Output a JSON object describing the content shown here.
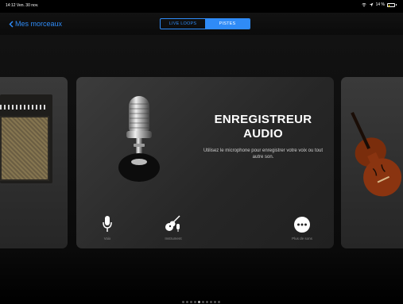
{
  "status": {
    "time_date": "14:12  Ven. 30 nov.",
    "battery_text": "14 %",
    "battery_level_percent": 14,
    "battery_color": "#ffd60a"
  },
  "nav": {
    "back_label": "Mes morceaux",
    "accent_color": "#2f8bf7"
  },
  "segments": {
    "live_loops": "LIVE LOOPS",
    "pistes": "PISTES",
    "selected": "PISTES"
  },
  "main_card": {
    "title_line1": "ENREGISTREUR",
    "title_line2": "AUDIO",
    "description": "Utilisez le microphone pour enregistrer votre voix ou tout autre son."
  },
  "buttons": {
    "voice": "Voix",
    "instrument": "Instrument",
    "more": "Plus de sons"
  },
  "side_cards": {
    "left": "amp",
    "right": "violin"
  },
  "page_dots": {
    "count": 10,
    "active_index": 4
  }
}
